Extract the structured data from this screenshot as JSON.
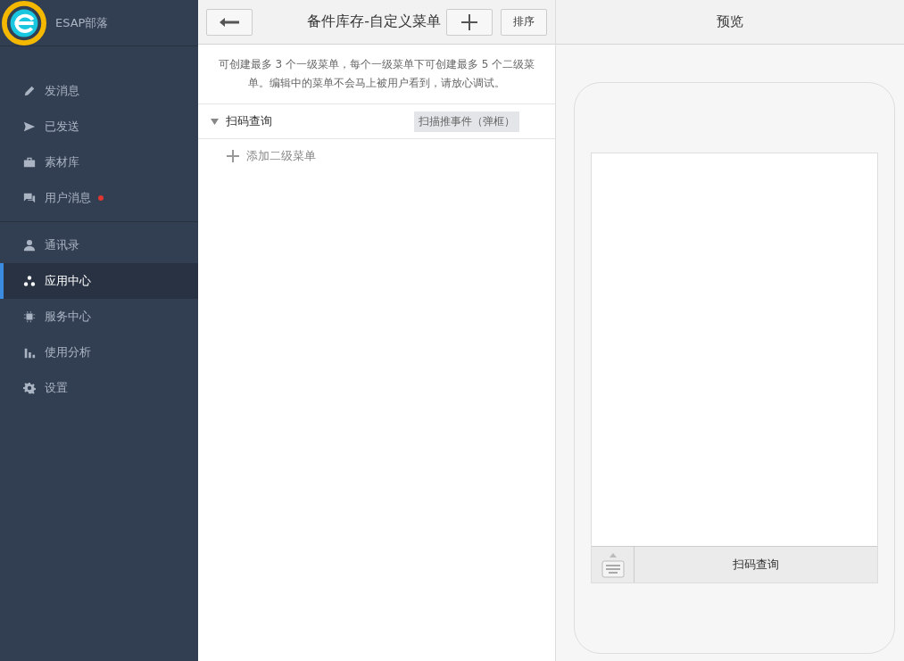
{
  "brand": {
    "name": "ESAP部落"
  },
  "sidebar": {
    "groups": [
      {
        "items": [
          {
            "label": "发消息",
            "selected": false,
            "badge": false
          },
          {
            "label": "已发送",
            "selected": false,
            "badge": false
          },
          {
            "label": "素材库",
            "selected": false,
            "badge": false
          },
          {
            "label": "用户消息",
            "selected": false,
            "badge": true
          }
        ]
      },
      {
        "items": [
          {
            "label": "通讯录",
            "selected": false,
            "badge": false
          },
          {
            "label": "应用中心",
            "selected": true,
            "badge": false
          },
          {
            "label": "服务中心",
            "selected": false,
            "badge": false
          },
          {
            "label": "使用分析",
            "selected": false,
            "badge": false
          },
          {
            "label": "设置",
            "selected": false,
            "badge": false
          }
        ]
      }
    ]
  },
  "editor": {
    "title": "备件库存-自定义菜单",
    "sort_button": "排序",
    "hint": "可创建最多 3 个一级菜单，每个一级菜单下可创建最多 5 个二级菜单。编辑中的菜单不会马上被用户看到，请放心调试。",
    "menus": [
      {
        "name": "扫码查询",
        "event": "扫描推事件（弹框）",
        "expanded": true,
        "add_sub": "添加二级菜单"
      }
    ]
  },
  "preview": {
    "title": "预览",
    "menu_buttons": [
      "扫码查询"
    ]
  }
}
